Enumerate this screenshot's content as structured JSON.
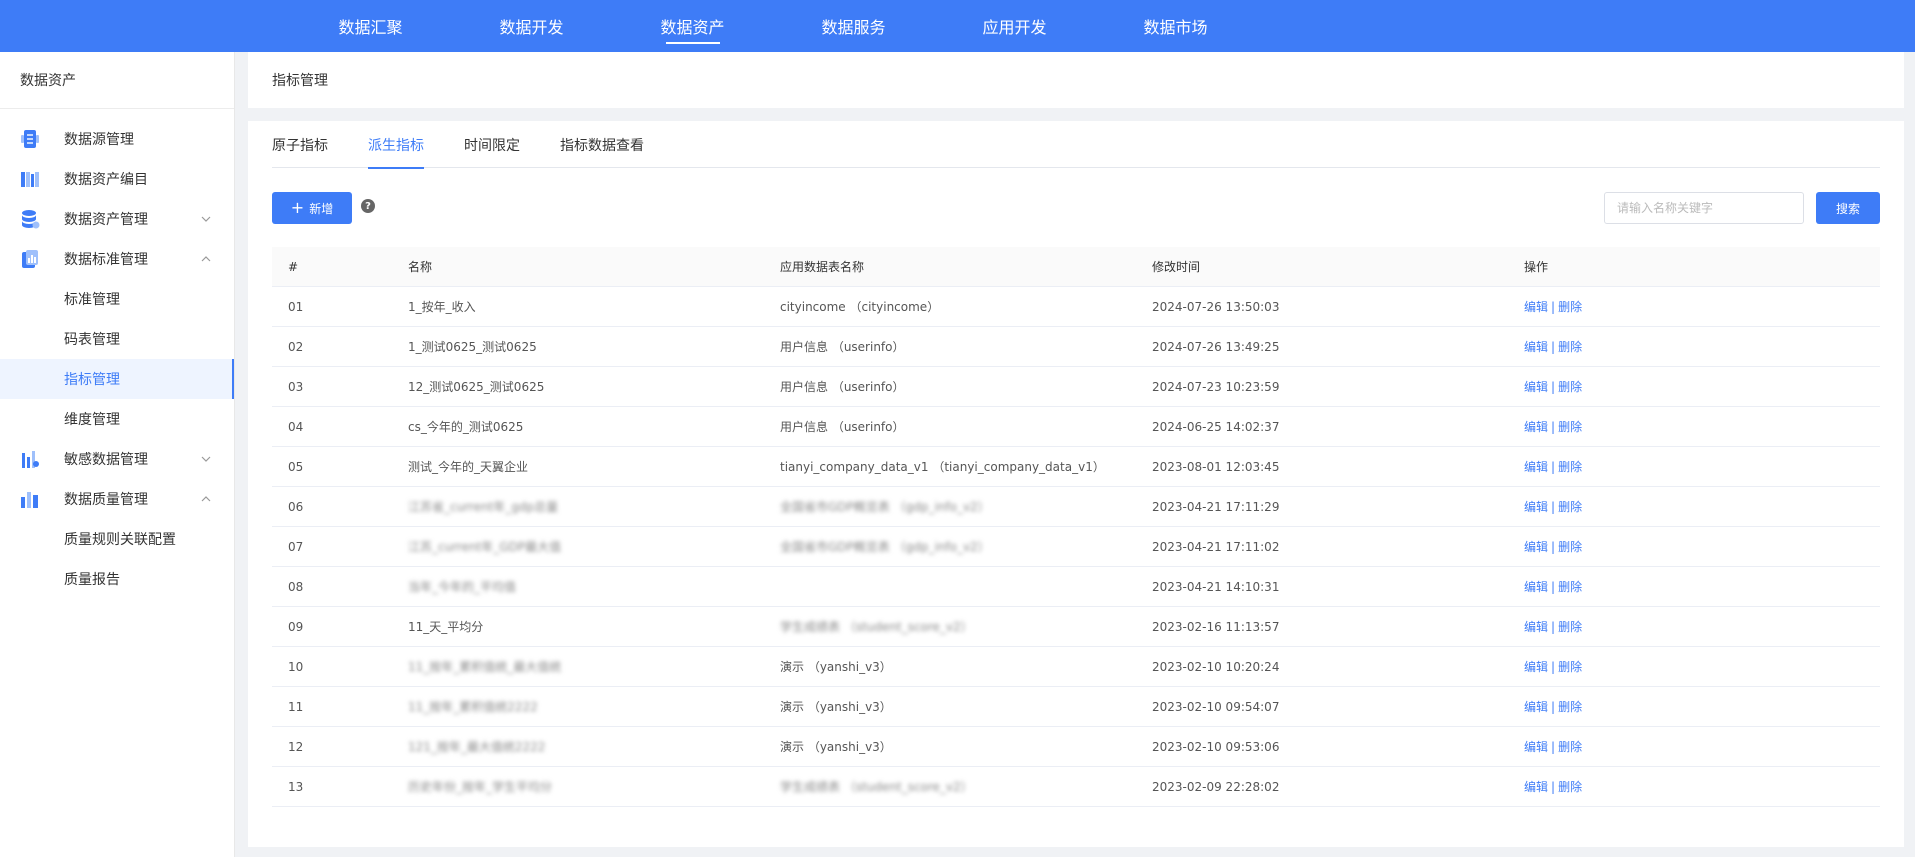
{
  "topnav": {
    "items": [
      {
        "label": "数据汇聚",
        "active": false
      },
      {
        "label": "数据开发",
        "active": false
      },
      {
        "label": "数据资产",
        "active": true
      },
      {
        "label": "数据服务",
        "active": false
      },
      {
        "label": "应用开发",
        "active": false
      },
      {
        "label": "数据市场",
        "active": false
      }
    ]
  },
  "sidebar": {
    "title": "数据资产",
    "items": [
      {
        "label": "数据源管理",
        "icon": "datasource-icon"
      },
      {
        "label": "数据资产编目",
        "icon": "catalog-icon"
      },
      {
        "label": "数据资产管理",
        "icon": "database-icon",
        "arrow": "down"
      },
      {
        "label": "数据标准管理",
        "icon": "standard-icon",
        "arrow": "up",
        "children": [
          "标准管理",
          "码表管理",
          "指标管理",
          "维度管理"
        ]
      },
      {
        "label": "敏感数据管理",
        "icon": "sensitive-icon",
        "arrow": "down"
      },
      {
        "label": "数据质量管理",
        "icon": "quality-icon",
        "arrow": "up",
        "children": [
          "质量规则关联配置",
          "质量报告"
        ]
      }
    ],
    "active_child": "指标管理"
  },
  "breadcrumb": "指标管理",
  "tabs": [
    {
      "label": "原子指标",
      "active": false
    },
    {
      "label": "派生指标",
      "active": true
    },
    {
      "label": "时间限定",
      "active": false
    },
    {
      "label": "指标数据查看",
      "active": false
    }
  ],
  "toolbar": {
    "add_label": "新增",
    "help_glyph": "?",
    "search_placeholder": "请输入名称关键字",
    "search_label": "搜索"
  },
  "table": {
    "columns": [
      "#",
      "名称",
      "应用数据表名称",
      "修改时间",
      "操作"
    ],
    "edit_label": "编辑",
    "delete_label": "删除",
    "rows": [
      {
        "no": "01",
        "name": "1_按年_收入",
        "table": "cityincome （cityincome）",
        "time": "2024-07-26 13:50:03",
        "blur_name": false,
        "blur_table": false
      },
      {
        "no": "02",
        "name": "1_测试0625_测试0625",
        "table": "用户信息 （userinfo）",
        "time": "2024-07-26 13:49:25",
        "blur_name": false,
        "blur_table": false
      },
      {
        "no": "03",
        "name": "12_测试0625_测试0625",
        "table": "用户信息 （userinfo）",
        "time": "2024-07-23 10:23:59",
        "blur_name": false,
        "blur_table": false
      },
      {
        "no": "04",
        "name": "cs_今年的_测试0625",
        "table": "用户信息 （userinfo）",
        "time": "2024-06-25 14:02:37",
        "blur_name": false,
        "blur_table": false
      },
      {
        "no": "05",
        "name": "测试_今年的_天翼企业",
        "table": "tianyi_company_data_v1 （tianyi_company_data_v1）",
        "time": "2023-08-01 12:03:45",
        "blur_name": false,
        "blur_table": false
      },
      {
        "no": "06",
        "name": "江苏省_current年_gdp总量",
        "table": "全国省市GDP概览表 （gdp_info_v2）",
        "time": "2023-04-21 17:11:29",
        "blur_name": true,
        "blur_table": true
      },
      {
        "no": "07",
        "name": "江苏_current年_GDP最大值",
        "table": "全国省市GDP概览表 （gdp_info_v2）",
        "time": "2023-04-21 17:11:02",
        "blur_name": true,
        "blur_table": true
      },
      {
        "no": "08",
        "name": "当年_今年的_平均值",
        "table": "",
        "time": "2023-04-21 14:10:31",
        "blur_name": true,
        "blur_table": false
      },
      {
        "no": "09",
        "name": "11_天_平均分",
        "table": "学生成绩表 （student_score_v2）",
        "time": "2023-02-16 11:13:57",
        "blur_name": false,
        "blur_table": true
      },
      {
        "no": "10",
        "name": "11_按年_累积值统_最大值统",
        "table": "演示 （yanshi_v3）",
        "time": "2023-02-10 10:20:24",
        "blur_name": true,
        "blur_table": false
      },
      {
        "no": "11",
        "name": "11_按年_累积值统2222",
        "table": "演示 （yanshi_v3）",
        "time": "2023-02-10 09:54:07",
        "blur_name": true,
        "blur_table": false
      },
      {
        "no": "12",
        "name": "121_按年_最大值统2222",
        "table": "演示 （yanshi_v3）",
        "time": "2023-02-10 09:53:06",
        "blur_name": true,
        "blur_table": false
      },
      {
        "no": "13",
        "name": "历史年份_按年_学生平均分",
        "table": "学生成绩表 （student_score_v2）",
        "time": "2023-02-09 22:28:02",
        "blur_name": true,
        "blur_table": true
      }
    ]
  },
  "colors": {
    "primary": "#3e7cf7",
    "page_bg": "#f0f2f5",
    "active_bg": "#eef4ff"
  }
}
